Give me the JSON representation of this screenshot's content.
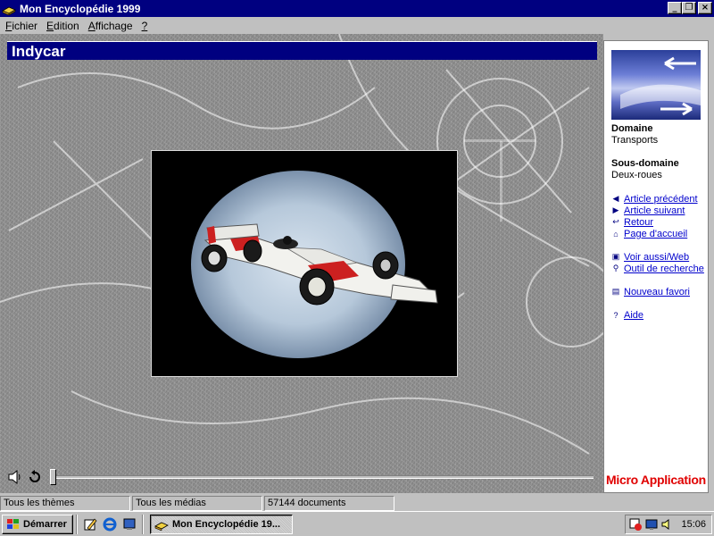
{
  "window": {
    "title": "Mon Encyclopédie 1999",
    "controls": {
      "minimize": "_",
      "maximize": "❐",
      "close": "×"
    }
  },
  "menu": {
    "items": [
      {
        "label": "Fichier",
        "accel": "F",
        "rest": "ichier"
      },
      {
        "label": "Edition",
        "accel": "E",
        "rest": "dition"
      },
      {
        "label": "Affichage",
        "accel": "A",
        "rest": "ffichage"
      },
      {
        "label": "?",
        "accel": "?",
        "rest": ""
      }
    ]
  },
  "article": {
    "title": "Indycar",
    "media_description_icon": "race-car-image"
  },
  "sidebar": {
    "domain_heading": "Domaine",
    "domain_value": "Transports",
    "subdomain_heading": "Sous-domaine",
    "subdomain_value": "Deux-roues",
    "links": [
      {
        "label": "Article précédent",
        "icon": "triangle-left-icon"
      },
      {
        "label": "Article suivant",
        "icon": "triangle-right-icon"
      },
      {
        "label": "Retour",
        "icon": "back-arrow-icon"
      },
      {
        "label": "Page d'accueil",
        "icon": "home-icon"
      },
      {
        "label": "Voir aussi/Web",
        "icon": "info-icon"
      },
      {
        "label": "Outil de recherche",
        "icon": "magnifier-icon"
      },
      {
        "label": "Nouveau favori",
        "icon": "bookmark-icon"
      },
      {
        "label": "Aide",
        "icon": "help-icon"
      }
    ],
    "brand": "Micro Application"
  },
  "status": {
    "themes": "Tous les thèmes",
    "media": "Tous les médias",
    "documents": "57144 documents"
  },
  "taskbar": {
    "start_label": "Démarrer",
    "task_label": "Mon Encyclopédie 19...",
    "clock": "15:06"
  },
  "colors": {
    "titlebar": "#000080",
    "link": "#0000cc",
    "brand": "#e00000"
  }
}
